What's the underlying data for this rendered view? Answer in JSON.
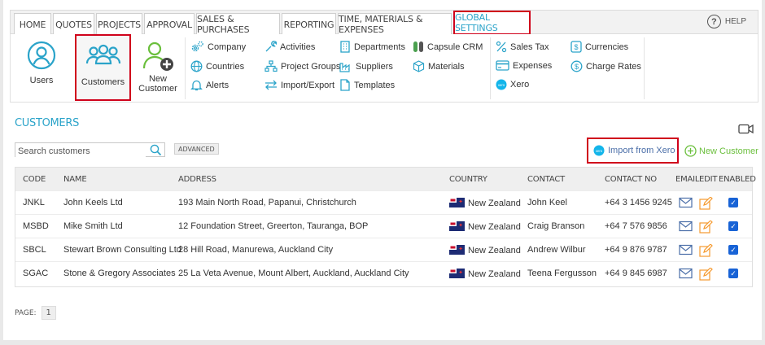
{
  "tabs": [
    "HOME",
    "QUOTES",
    "PROJECTS",
    "APPROVAL",
    "SALES & PURCHASES",
    "REPORTING",
    "TIME, MATERIALS & EXPENSES",
    "GLOBAL SETTINGS"
  ],
  "active_tab": "GLOBAL SETTINGS",
  "help_label": "HELP",
  "ribbon": {
    "users": "Users",
    "customers": "Customers",
    "new_customer_1": "New",
    "new_customer_2": "Customer",
    "col1": [
      "Company",
      "Countries",
      "Alerts"
    ],
    "col2": [
      "Activities",
      "Project Groups",
      "Import/Export"
    ],
    "col3": [
      "Departments",
      "Suppliers",
      "Templates"
    ],
    "col4": [
      "Capsule CRM",
      "Materials"
    ],
    "col5": [
      "Sales Tax",
      "Expenses",
      "Xero"
    ],
    "col6": [
      "Currencies",
      "Charge Rates"
    ]
  },
  "section_title": "CUSTOMERS",
  "search": {
    "placeholder": "Search customers"
  },
  "advanced_label": "ADVANCED",
  "import_label": "Import from Xero",
  "new_customer_label": "New Customer",
  "table": {
    "headers": [
      "CODE",
      "NAME",
      "ADDRESS",
      "COUNTRY",
      "CONTACT",
      "CONTACT NO",
      "EMAIL",
      "EDIT",
      "ENABLED"
    ],
    "rows": [
      {
        "code": "JNKL",
        "name": "John Keels Ltd",
        "address": "193 Main North Road, Papanui, Christchurch",
        "country": "New Zealand",
        "contact": "John Keel",
        "phone": "+64 3 1456 9245",
        "enabled": true
      },
      {
        "code": "MSBD",
        "name": "Mike Smith Ltd",
        "address": "12 Foundation Street, Greerton, Tauranga, BOP",
        "country": "New Zealand",
        "contact": "Craig Branson",
        "phone": "+64 7 576 9856",
        "enabled": true
      },
      {
        "code": "SBCL",
        "name": "Stewart Brown Consulting Ltd",
        "address": "28 Hill Road, Manurewa, Auckland City",
        "country": "New Zealand",
        "contact": "Andrew Wilbur",
        "phone": "+64 9 876 9787",
        "enabled": true
      },
      {
        "code": "SGAC",
        "name": "Stone & Gregory Associates",
        "address": "25 La Veta Avenue, Mount Albert, Auckland, Auckland City",
        "country": "New Zealand",
        "contact": "Teena Fergusson",
        "phone": "+64 9 845 6987",
        "enabled": true
      }
    ]
  },
  "pager": {
    "label": "PAGE:",
    "current": "1"
  },
  "colors": {
    "accent": "#2aa3c9",
    "highlight": "#d0021b",
    "new": "#6abf3c",
    "checkbox": "#1863d6"
  },
  "icons": [
    "users-icon",
    "customers-icon",
    "new-customer-icon",
    "gear-icon",
    "globe-icon",
    "bell-icon",
    "wrench-icon",
    "hierarchy-icon",
    "import-export-icon",
    "building-icon",
    "factory-icon",
    "document-icon",
    "capsule-icon",
    "box-icon",
    "percent-icon",
    "card-icon",
    "xero-icon",
    "dollar-icon",
    "search-icon",
    "video-icon",
    "mail-icon",
    "edit-icon",
    "check-icon"
  ]
}
